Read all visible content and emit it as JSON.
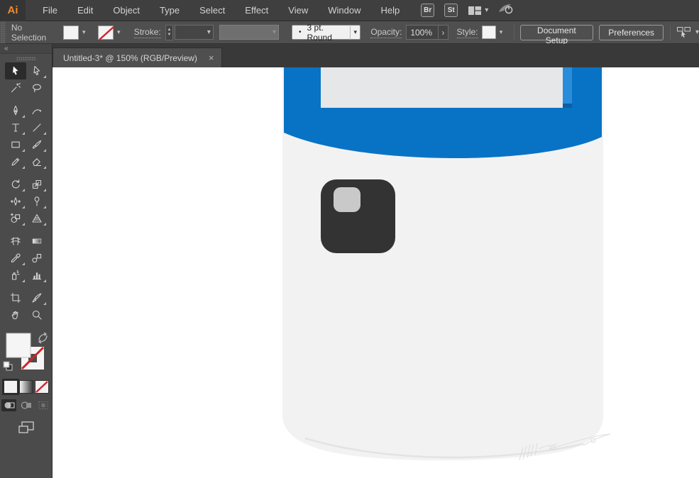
{
  "menubar": {
    "logo": "Ai",
    "items": [
      "File",
      "Edit",
      "Object",
      "Type",
      "Select",
      "Effect",
      "View",
      "Window",
      "Help"
    ],
    "bridge_badge": "Br",
    "stock_badge": "St"
  },
  "controlbar": {
    "selection_status": "No Selection",
    "stroke_label": "Stroke:",
    "brush_preview_dot": "•",
    "brush_value": "3 pt. Round",
    "opacity_label": "Opacity:",
    "opacity_value": "100%",
    "style_label": "Style:",
    "document_setup_button": "Document Setup",
    "preferences_button": "Preferences"
  },
  "tabbar": {
    "tab_title": "Untitled-3* @ 150% (RGB/Preview)"
  },
  "toolbar": {
    "active_tool": "selection-tool",
    "tools": [
      "selection-tool",
      "direct-selection-tool",
      "magic-wand-tool",
      "lasso-tool",
      "pen-tool",
      "curvature-tool",
      "type-tool",
      "line-segment-tool",
      "rectangle-tool",
      "paintbrush-tool",
      "pencil-tool",
      "eraser-tool",
      "rotate-tool",
      "scale-tool",
      "width-tool",
      "free-transform-tool",
      "shape-builder-tool",
      "perspective-grid-tool",
      "mesh-tool",
      "gradient-tool",
      "eyedropper-tool",
      "blend-tool",
      "symbol-sprayer-tool",
      "column-graph-tool",
      "artboard-tool",
      "slice-tool",
      "hand-tool",
      "zoom-tool"
    ],
    "fill_color": "#f5f5f5",
    "stroke_color": "none"
  },
  "icons": {
    "collapse": "«",
    "chevron_down": "▾",
    "stepper_up": "▲",
    "stepper_down": "▼",
    "go_arrow": "›",
    "close": "×"
  },
  "canvas": {
    "artwork_colors": {
      "header_blue": "#0873c5",
      "accent_light_blue": "#2a8ddb",
      "accent_dark_blue": "#0d5fa4",
      "screen_gray": "#e6e7e8",
      "body_gray": "#f2f2f3",
      "body_shadow": "#e3e3e4",
      "camera_body": "#333333",
      "camera_lens": "#c9c9c9",
      "canvas_bg": "#ffffff"
    }
  },
  "theme": {
    "menubar_bg": "#3f3f3f",
    "controlbar_bg": "#4f4f4f",
    "tabbar_bg": "#393939",
    "panel_bg": "#4b4b4b",
    "logo_orange": "#ef8d2e",
    "none_red": "#d3222a",
    "text": "#d6d6d6"
  }
}
